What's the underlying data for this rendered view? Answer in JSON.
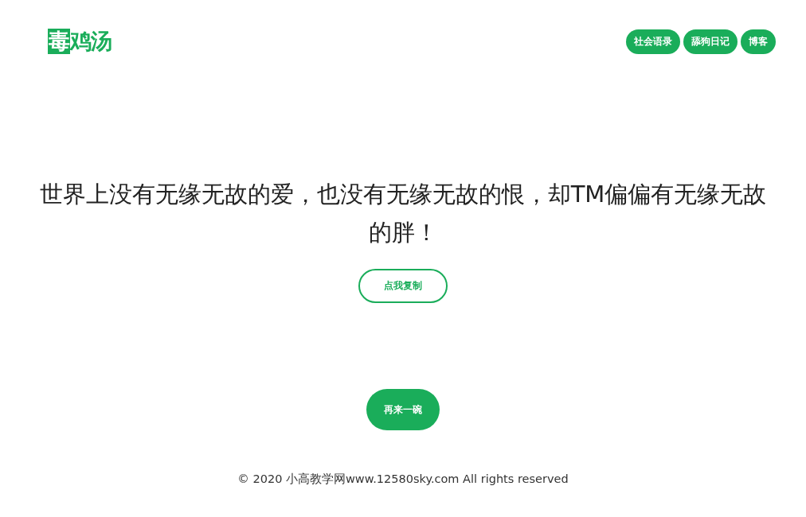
{
  "logo": "毒鸡汤",
  "nav": [
    {
      "label": "社会语录"
    },
    {
      "label": "舔狗日记"
    },
    {
      "label": "博客"
    }
  ],
  "quote": "世界上没有无缘无故的爱，也没有无缘无故的恨，却TM偏偏有无缘无故的胖！",
  "copy_button": "点我复制",
  "more_button": "再来一碗",
  "footer": "© 2020 小高教学网www.12580sky.com All rights reserved"
}
